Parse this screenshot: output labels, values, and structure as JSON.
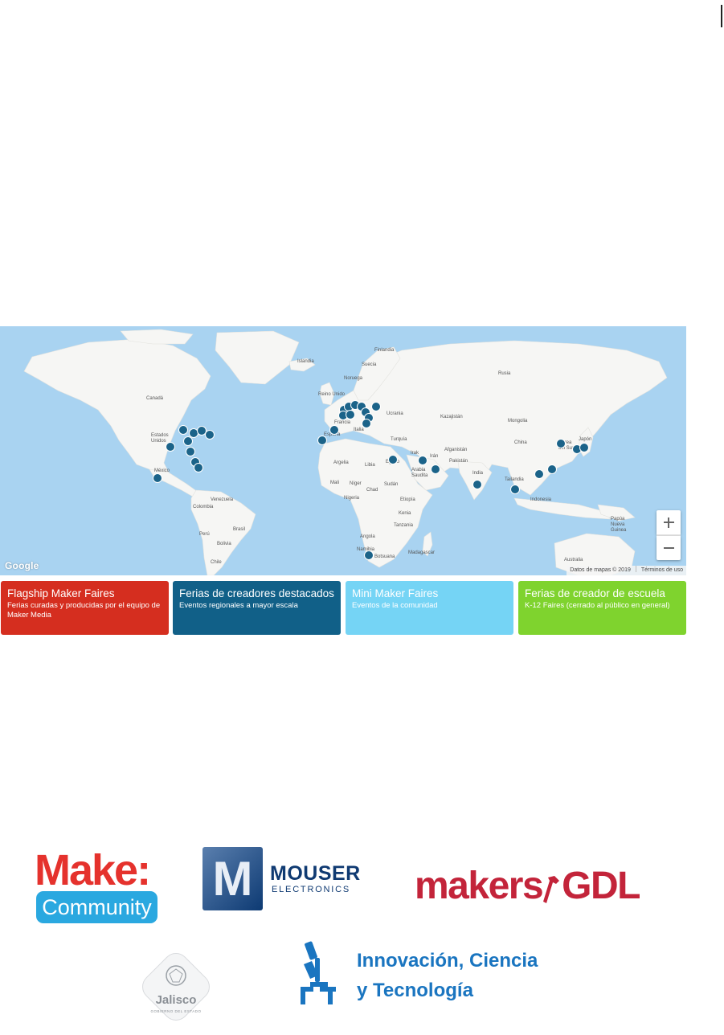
{
  "map": {
    "labels": {
      "finlandia": "Finlandia",
      "islandia": "Islandia",
      "suecia": "Suecia",
      "noruega": "Noruega",
      "rusia": "Rusia",
      "canada": "Canadá",
      "reino_unido": "Reino Unido",
      "ucrania": "Ucrania",
      "kazajistan": "Kazajistán",
      "mongolia": "Mongolia",
      "francia": "Francia",
      "italia": "Italia",
      "espana": "España",
      "estados_unidos": "Estados Unidos",
      "turquia": "Turquía",
      "china": "China",
      "japon": "Japón",
      "corea": "Corea del Sur",
      "afganistan": "Afganistán",
      "irak": "Irak",
      "iran": "Irán",
      "pakistan": "Pakistán",
      "argelia": "Argelia",
      "libia": "Libia",
      "egipto": "Egipto",
      "arabia": "Arabia Saudita",
      "india": "India",
      "mexico": "México",
      "tailandia": "Tailandia",
      "mali": "Mali",
      "niger": "Níger",
      "chad": "Chad",
      "sudan": "Sudán",
      "venezuela": "Venezuela",
      "nigeria": "Nigeria",
      "etiopia": "Etiopía",
      "colombia": "Colombia",
      "kenia": "Kenia",
      "indonesia": "Indonesia",
      "tanzania": "Tanzania",
      "papua": "Papúa Nueva Guinea",
      "brasil": "Brasil",
      "peru": "Perú",
      "angola": "Angola",
      "bolivia": "Bolivia",
      "namibia": "Namibia",
      "botsuana": "Botsuana",
      "madagascar": "Madagascar",
      "australia": "Australia",
      "chile": "Chile"
    },
    "google": "Google",
    "map_data": "Datos de mapas © 2019",
    "terms": "Términos de uso",
    "zoom_in": "+",
    "zoom_out": "−",
    "pin_color": "#1b6389",
    "water_color": "#a9d3f1",
    "land_color": "#f6f6f4"
  },
  "legend": [
    {
      "title": "Flagship Maker Faires",
      "subtitle": "Ferias curadas y producidas por el equipo de Maker Media",
      "color": "#d52e1f"
    },
    {
      "title": "Ferias de creadores destacados",
      "subtitle": "Eventos regionales a mayor escala",
      "color": "#116088"
    },
    {
      "title": "Mini Maker Faires",
      "subtitle": "Eventos de la comunidad",
      "color": "#75d4f5"
    },
    {
      "title": "Ferias de creador de escuela",
      "subtitle": "K-12 Faires (cerrado al público en general)",
      "color": "#7fd32e"
    }
  ],
  "logos": {
    "make": "Make:",
    "community": "Community",
    "mouser_letter": "M",
    "mouser": "MOUSER",
    "electronics": "ELECTRONICS",
    "makers": "makers",
    "gdl": "GDL",
    "jalisco": "Jalisco",
    "jalisco_sub": "GOBIERNO DEL ESTADO",
    "innov_line1": "Innovación, Ciencia",
    "innov_line2": "y Tecnología"
  }
}
